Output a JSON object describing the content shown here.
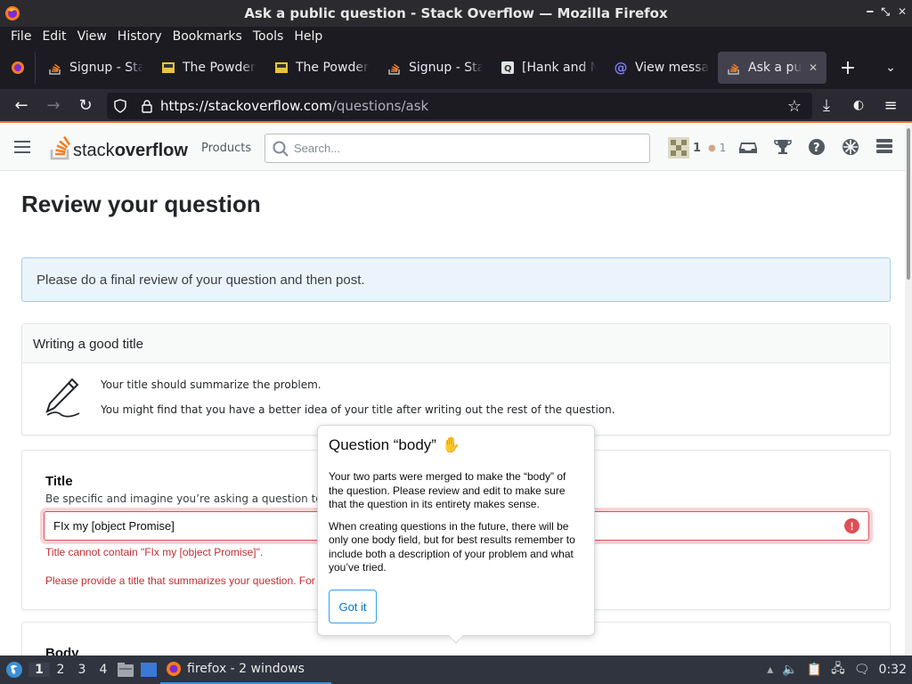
{
  "window": {
    "title": "Ask a public question - Stack Overflow — Mozilla Firefox"
  },
  "menu": [
    "File",
    "Edit",
    "View",
    "History",
    "Bookmarks",
    "Tools",
    "Help"
  ],
  "tabs": [
    {
      "label": "Signup - Stac",
      "icon": "stackoverflow-icon"
    },
    {
      "label": "The Powder T",
      "icon": "powder-icon"
    },
    {
      "label": "The Powder T",
      "icon": "powder-icon"
    },
    {
      "label": "Signup - Stac",
      "icon": "stackoverflow-icon"
    },
    {
      "label": "[Hank and M",
      "icon": "q-icon"
    },
    {
      "label": "View messag",
      "icon": "at-icon"
    },
    {
      "label": "Ask a publ",
      "icon": "stackoverflow-icon",
      "active": true
    }
  ],
  "url": {
    "base": "https://stackoverflow.com",
    "path": "/questions/ask"
  },
  "so": {
    "logo_text_a": "stack",
    "logo_text_b": "overflow",
    "products": "Products",
    "search_placeholder": "Search...",
    "rep": "1",
    "bronze": "1"
  },
  "page": {
    "title": "Review your question",
    "notice": "Please do a final review of your question and then post."
  },
  "good_title": {
    "header": "Writing a good title",
    "line1": "Your title should summarize the problem.",
    "line2": "You might find that you have a better idea of your title after writing out the rest of the question."
  },
  "title_section": {
    "label": "Title",
    "hint": "Be specific and imagine you’re asking a question to anoth",
    "value": "FIx my [object Promise]",
    "error1": "Title cannot contain \"FIx my [object Promise]\".",
    "error2": "Please provide a title that summarizes your question. For"
  },
  "body_section": {
    "label": "Body"
  },
  "popover": {
    "title": "Question “body”",
    "p1": "Your two parts were merged to make the “body” of the question. Please review and edit to make sure that the question in its entirety makes sense.",
    "p2": "When creating questions in the future, there will be only one body field, but for best results remember to include both a description of your problem and what you’ve tried.",
    "button": "Got it"
  },
  "taskbar": {
    "workspaces": [
      "1",
      "2",
      "3",
      "4"
    ],
    "app": "firefox - 2 windows",
    "clock": "0:32"
  }
}
